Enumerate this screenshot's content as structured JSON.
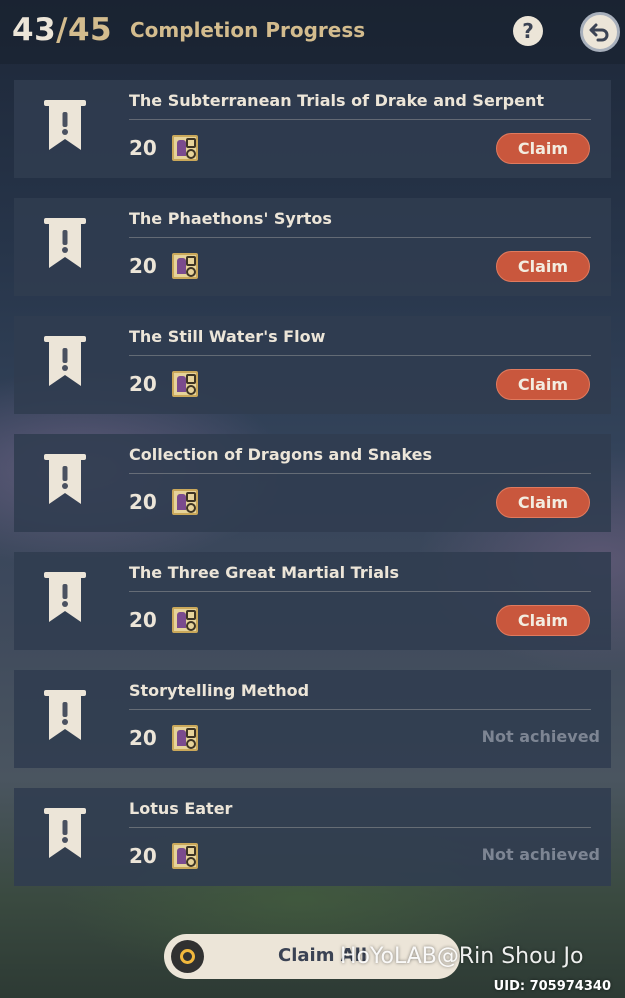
{
  "header": {
    "completed": "43",
    "separator": "/",
    "total": "45",
    "title": "Completion Progress",
    "help_icon": "question-icon",
    "help_label": "?",
    "back_icon": "back-arrow-icon"
  },
  "achievements": [
    {
      "title": "The Subterranean Trials of Drake and Serpent",
      "reward": "20",
      "status": "claim",
      "action_label": "Claim"
    },
    {
      "title": "The Phaethons' Syrtos",
      "reward": "20",
      "status": "claim",
      "action_label": "Claim"
    },
    {
      "title": "The Still Water's Flow",
      "reward": "20",
      "status": "claim",
      "action_label": "Claim"
    },
    {
      "title": "Collection of Dragons and Snakes",
      "reward": "20",
      "status": "claim",
      "action_label": "Claim"
    },
    {
      "title": "The Three Great Martial Trials",
      "reward": "20",
      "status": "claim",
      "action_label": "Claim"
    },
    {
      "title": "Storytelling Method",
      "reward": "20",
      "status": "not_achieved",
      "action_label": "Not achieved"
    },
    {
      "title": "Lotus Eater",
      "reward": "20",
      "status": "not_achieved",
      "action_label": "Not achieved"
    }
  ],
  "footer": {
    "claim_all_label": "Claim All",
    "watermark": "HoYoLAB@Rin Shou Jo",
    "uid": "UID: 705974340"
  },
  "colors": {
    "claim_button": "#c9573d",
    "gold": "#d3bc8e",
    "panel": "#303c50",
    "cream": "#ece5d8",
    "not_achieved_text": "#7d8593"
  },
  "icons": {
    "achievement": "achievement-banner-icon",
    "reward": "fate-card-icon"
  }
}
